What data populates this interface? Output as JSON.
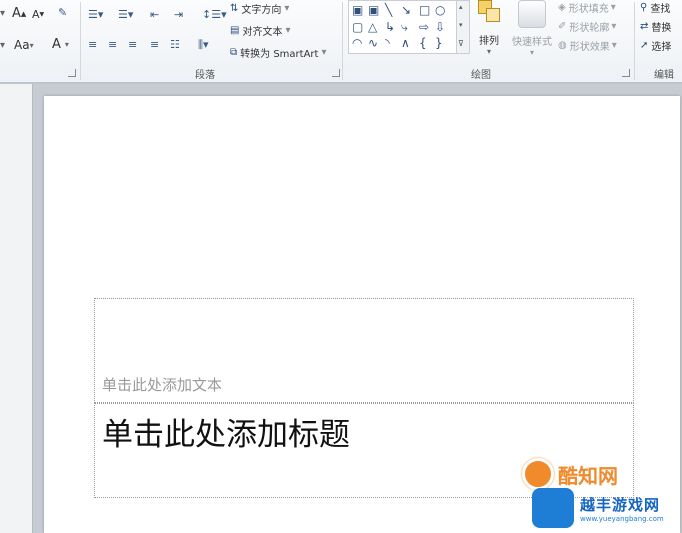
{
  "font_group": {
    "grow_font": "A",
    "shrink_font": "A",
    "case_label": "Aa",
    "font_color": "A"
  },
  "paragraph_group": {
    "label": "段落",
    "text_direction": "文字方向",
    "align_text": "对齐文本",
    "convert_smartart": "转换为 SmartArt"
  },
  "drawing_group": {
    "label": "绘图",
    "arrange": "排列",
    "quick_styles": "快速样式",
    "shape_fill": "形状填充",
    "shape_outline": "形状轮廓",
    "shape_effects": "形状效果"
  },
  "editing_group": {
    "label": "编辑",
    "find": "查找",
    "replace": "替换",
    "select": "选择"
  },
  "slide": {
    "subtitle_placeholder": "单击此处添加文本",
    "title_placeholder": "单击此处添加标题"
  },
  "watermarks": {
    "site1": "酷知网",
    "site2": "越丰游戏网",
    "site2_url": "www.yueyangbang.com"
  }
}
